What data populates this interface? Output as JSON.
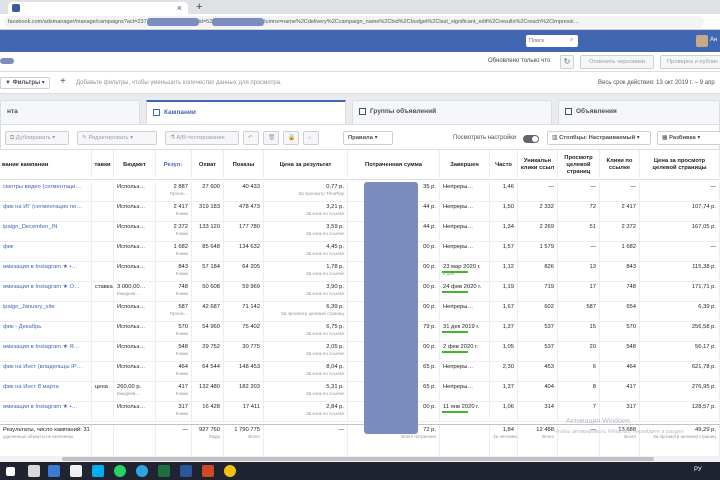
{
  "browser": {
    "url_start": "facebook.com/adsmanager/manage/campaigns?act=237",
    "url_mid": "id=52",
    "url_end": "lumns=name%2Cdelivery%2Ccampaign_name%2Cbid%2Cbudget%2Clast_significant_edit%2Cresults%2Creach%2Cimpressi…",
    "new_tab": "+"
  },
  "fb": {
    "search_placeholder": "Поиск",
    "user_name": "Ан"
  },
  "account": {
    "updated_text": "Обновлено только что",
    "refresh_icon": "↻",
    "discard_label": "Отменить черновики",
    "publish_label": "Проверка и публик"
  },
  "filters": {
    "filter_label": "Фильтры",
    "plus": "+",
    "hint": "Добавьте фильтры, чтобы уменьшить количество данных для просмотра.",
    "date_range": "Весь срок действия: 13 окт 2019 г. – 9 апр"
  },
  "level_tabs": [
    {
      "label": "нта"
    },
    {
      "label": "Кампании"
    },
    {
      "label": "Группы объявлений"
    },
    {
      "label": "Объявления"
    }
  ],
  "toolbar": {
    "duplicate": "Дублировать",
    "edit": "Редактировать",
    "ab_test": "A/B-тестирование",
    "rules": "Правила",
    "show_settings": "Посмотреть настройки",
    "columns": "Столбцы: Настраиваемый",
    "breakdown": "Разбивка"
  },
  "columns": [
    "вание кампании",
    "тавки",
    "Бюджет",
    "Резул",
    "Охват",
    "Показы",
    "Цена за результат",
    "Потраченная сумма",
    "Завершен",
    "Часто",
    "Уникальн клики ссыл",
    "Просмотр целевой страниц",
    "Клики по ссылке",
    "Цена за просмотр целевой страницы"
  ],
  "rows": [
    {
      "name": "смотры видео (сегментаци…",
      "bid": "",
      "budget": "Использ…",
      "results": "2 887",
      "results_sub": "Просм…",
      "reach": "27 600",
      "impressions": "40 433",
      "cpr": "0,77 р.",
      "cpr_sub": "За просмотр ThruPlay",
      "spent": "35 р.",
      "end": "Непреры…",
      "freq": "1,46",
      "uclicks": "—",
      "lpv": "—",
      "clicks": "—",
      "cplpv": "—"
    },
    {
      "name": "фик на ИГ (сегментацио по…",
      "bid": "",
      "budget": "Использ…",
      "results": "2 417",
      "results_sub": "Клики",
      "reach": "319 183",
      "impressions": "478 473",
      "cpr": "3,21 р.",
      "cpr_sub": "За клик по ссылке",
      "spent": "44 р.",
      "end": "Непреры…",
      "freq": "1,50",
      "uclicks": "2 332",
      "lpv": "72",
      "clicks": "2 417",
      "cplpv": "107,74 р."
    },
    {
      "name": "ipaign_December_IN",
      "bid": "",
      "budget": "Использ…",
      "results": "2 372",
      "results_sub": "Клики",
      "reach": "133 120",
      "impressions": "177 780",
      "cpr": "3,59 р.",
      "cpr_sub": "За клик по ссылке",
      "spent": "44 р.",
      "end": "Непреры…",
      "freq": "1,34",
      "uclicks": "2 269",
      "lpv": "51",
      "clicks": "2 372",
      "cplpv": "167,05 р."
    },
    {
      "name": "фик",
      "bid": "",
      "budget": "Использ…",
      "results": "1 682",
      "results_sub": "Клики",
      "reach": "85 648",
      "impressions": "134 632",
      "cpr": "4,45 р.",
      "cpr_sub": "За клик по ссылке",
      "spent": "00 р.",
      "end": "Непреры…",
      "freq": "1,57",
      "uclicks": "1 579",
      "lpv": "—",
      "clicks": "1 682",
      "cplpv": "—"
    },
    {
      "name": "имизация в Instagram ★ •…",
      "bid": "",
      "budget": "Использ…",
      "results": "843",
      "results_sub": "Клики",
      "reach": "57 184",
      "impressions": "64 205",
      "cpr": "1,78 р.",
      "cpr_sub": "За клик по ссылке",
      "spent": "00 р.",
      "end": "23 мар 2020 г.",
      "end_sub": "2 дня",
      "freq": "1,12",
      "uclicks": "826",
      "lpv": "13",
      "clicks": "843",
      "cplpv": "115,38 р."
    },
    {
      "name": "имизация в Instagram ★ О…",
      "bid": "ставка",
      "budget": "3 000,00…",
      "budget_sub": "Ежеднев…",
      "results": "748",
      "results_sub": "Клики",
      "reach": "50 608",
      "impressions": "59 969",
      "cpr": "3,90 р.",
      "cpr_sub": "За клик по ссылке",
      "spent": "00 р.",
      "end": "24 фев 2020 г.",
      "end_sub": "…",
      "freq": "1,19",
      "uclicks": "719",
      "lpv": "17",
      "clicks": "748",
      "cplpv": "171,71 р."
    },
    {
      "name": "ipaign_January_site",
      "bid": "",
      "budget": "Использ…",
      "results": "587",
      "results_sub": "Просм…",
      "reach": "42 687",
      "impressions": "71 142",
      "cpr": "6,39 р.",
      "cpr_sub": "За просмотр целевой страниц",
      "spent": "00 р.",
      "end": "Непреры…",
      "freq": "1,67",
      "uclicks": "602",
      "lpv": "587",
      "clicks": "654",
      "cplpv": "6,39 р."
    },
    {
      "name": "фик - Декабрь",
      "bid": "",
      "budget": "Использ…",
      "results": "570",
      "results_sub": "Клики",
      "reach": "54 960",
      "impressions": "75 402",
      "cpr": "6,75 р.",
      "cpr_sub": "За клик по ссылке",
      "spent": "79 р.",
      "end": "31 дек 2019 г.",
      "end_sub": "…",
      "freq": "1,37",
      "uclicks": "537",
      "lpv": "15",
      "clicks": "570",
      "cplpv": "256,58 р."
    },
    {
      "name": "имизация в Instagram ★ Я…",
      "bid": "",
      "budget": "Использ…",
      "results": "548",
      "results_sub": "Клики",
      "reach": "29 752",
      "impressions": "30 775",
      "cpr": "2,05 р.",
      "cpr_sub": "За клик по ссылке",
      "spent": "00 р.",
      "end": "2 фев 2020 г.",
      "end_sub": "…",
      "freq": "1,05",
      "uclicks": "537",
      "lpv": "20",
      "clicks": "548",
      "cplpv": "56,17 р."
    },
    {
      "name": "фик на Инст (владельцы IP…",
      "bid": "",
      "budget": "Использ…",
      "results": "464",
      "results_sub": "Клики",
      "reach": "64 544",
      "impressions": "148 453",
      "cpr": "8,04 р.",
      "cpr_sub": "За клик по ссылке",
      "spent": "65 р.",
      "end": "Непреры…",
      "freq": "2,30",
      "uclicks": "453",
      "lpv": "6",
      "clicks": "464",
      "cplpv": "621,78 р."
    },
    {
      "name": "фик на Инст 8 марта",
      "bid": "цена",
      "budget": "260,00 р.",
      "budget_sub": "Ежеднев…",
      "results": "417",
      "results_sub": "Клики",
      "reach": "132 480",
      "impressions": "182 203",
      "cpr": "5,31 р.",
      "cpr_sub": "За клик по ссылке",
      "spent": "65 р.",
      "end": "Непреры…",
      "freq": "1,37",
      "uclicks": "404",
      "lpv": "8",
      "clicks": "417",
      "cplpv": "276,95 р."
    },
    {
      "name": "имизация в Instagram ★ •…",
      "bid": "",
      "budget": "Использ…",
      "results": "317",
      "results_sub": "Клики",
      "reach": "16 428",
      "impressions": "17 411",
      "cpr": "2,84 р.",
      "cpr_sub": "За клик по ссылке",
      "spent": "00 р.",
      "end": "11 янв 2020 г.",
      "end_sub": "…",
      "freq": "1,06",
      "uclicks": "314",
      "lpv": "7",
      "clicks": "317",
      "cplpv": "128,57 р."
    }
  ],
  "summary": {
    "name": "Результаты, число кампаний: 31",
    "name_sub": "удаленные объекты не включены",
    "results": "—",
    "reach": "927 760",
    "reach_sub": "Люди",
    "impressions": "1 790 775",
    "impressions_sub": "Всего",
    "cpr": "—",
    "spent": "72 р.",
    "spent_sub": "Всего потрачено",
    "freq": "1,84",
    "freq_sub": "За человека",
    "uclicks": "12 488",
    "uclicks_sub": "Всего",
    "lpv": "—",
    "clicks": "13 688",
    "clicks_sub": "Всего",
    "cplpv": "49,29 р.",
    "cplpv_sub": "За просмотр целевой страниц"
  },
  "watermark": {
    "line1": "Активация Windows",
    "line2": "Чтобы активировать Windows, перейдите в раздел"
  },
  "taskbar": {
    "lang": "РУ"
  },
  "colors": {
    "fb_blue": "#4267b2",
    "link": "#4267b2",
    "progress_green": "#42b72a",
    "redaction": "#7b8dbf"
  }
}
